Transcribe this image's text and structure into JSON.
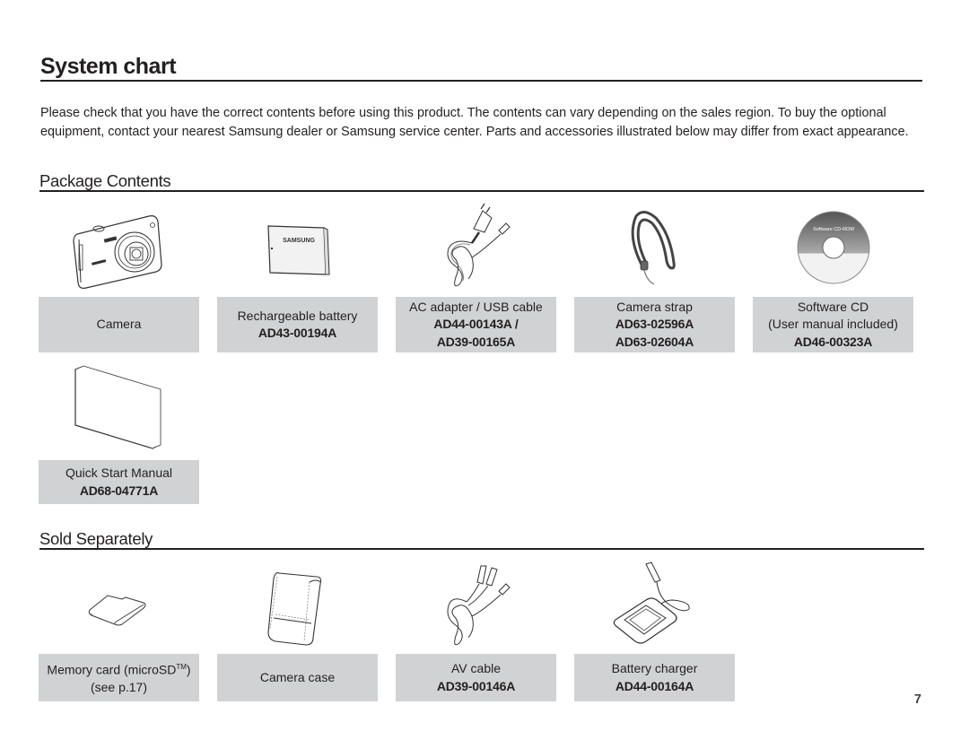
{
  "page": {
    "title": "System chart",
    "intro": "Please check that you have the correct contents before using this product. The contents can vary depending on the sales region. To buy the optional equipment, contact your nearest Samsung dealer or Samsung service center. Parts and accessories illustrated below may differ from exact appearance.",
    "page_number": "7"
  },
  "package_contents": {
    "heading": "Package Contents",
    "items": [
      {
        "icon": "camera-icon",
        "name": "Camera",
        "codes": []
      },
      {
        "icon": "battery-icon",
        "name": "Rechargeable battery",
        "codes": [
          "AD43-00194A"
        ],
        "label_text": "SAMSUNG"
      },
      {
        "icon": "ac-adapter-usb-cable-icon",
        "name": "AC adapter / USB cable",
        "codes": [
          "AD44-00143A /",
          "AD39-00165A"
        ]
      },
      {
        "icon": "camera-strap-icon",
        "name": "Camera strap",
        "codes": [
          "AD63-02596A",
          "AD63-02604A"
        ]
      },
      {
        "icon": "software-cd-icon",
        "name": "Software CD",
        "sub": "(User manual included)",
        "codes": [
          "AD46-00323A"
        ],
        "label_text": "Software CD-ROM"
      },
      {
        "icon": "quick-start-manual-icon",
        "name": "Quick Start Manual",
        "codes": [
          "AD68-04771A"
        ]
      }
    ]
  },
  "sold_separately": {
    "heading": "Sold Separately",
    "items": [
      {
        "icon": "memory-card-icon",
        "name": "Memory card (microSD",
        "trademark": "TM",
        "name_suffix": ")",
        "sub": "(see p.17)",
        "codes": []
      },
      {
        "icon": "camera-case-icon",
        "name": "Camera case",
        "codes": []
      },
      {
        "icon": "av-cable-icon",
        "name": "AV cable",
        "codes": [
          "AD39-00146A"
        ]
      },
      {
        "icon": "battery-charger-icon",
        "name": "Battery charger",
        "codes": [
          "AD44-00164A"
        ]
      }
    ]
  },
  "colors": {
    "label_box": "#d1d2d4",
    "text": "#231f20"
  }
}
